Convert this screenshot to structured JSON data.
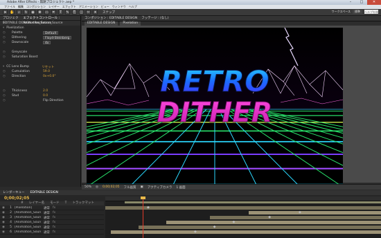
{
  "window": {
    "title": "Adobe After Effects - 無題プロジェクト.aep *"
  },
  "menu": [
    "ファイル",
    "編集",
    "コンポジション",
    "レイヤー",
    "エフェクト",
    "アニメーション",
    "ビュー",
    "ウィンドウ",
    "ヘルプ"
  ],
  "toolbar": {
    "icons": [
      "select",
      "hand",
      "zoom",
      "rotate",
      "camera",
      "pan",
      "rect",
      "pen",
      "text",
      "brush",
      "clone",
      "eraser",
      "roto",
      "puppet"
    ],
    "snap_label": "スナップ",
    "workspace_label": "ワークスペース",
    "workspace_value": "標準",
    "search_placeholder": "ヘルプを検索"
  },
  "left_panel": {
    "tabs": [
      "プロジェクト",
      "エフェクトコントロール : Animation_Source"
    ],
    "header": "EDITABLE DESIGN • Animation_Source",
    "rows": [
      {
        "label": "Pixelization",
        "value": "",
        "kind": "group"
      },
      {
        "label": "Palette",
        "value": "Default",
        "kind": "dropdown"
      },
      {
        "label": "Dithering",
        "value": "Floyd-Steinberg",
        "kind": "dropdown"
      },
      {
        "label": "Downscale",
        "value": "4x",
        "kind": "dropdown"
      },
      {
        "label": "",
        "value": "",
        "kind": "blank"
      },
      {
        "label": "Greyscale",
        "value": "",
        "kind": "check"
      },
      {
        "label": "Saturation Boost",
        "value": "",
        "kind": "check"
      },
      {
        "label": "",
        "value": "",
        "kind": "blank"
      },
      {
        "label": "CC Lens Bump",
        "value": "リセット",
        "kind": "group"
      },
      {
        "label": "Cumulation",
        "value": "59.0",
        "kind": "value"
      },
      {
        "label": "Direction",
        "value": "0x+0.0°",
        "kind": "value"
      },
      {
        "label": "",
        "value": "",
        "kind": "blank"
      },
      {
        "label": "",
        "value": "",
        "kind": "blank"
      },
      {
        "label": "Thickness",
        "value": "2.0",
        "kind": "value"
      },
      {
        "label": "Stud",
        "value": "0.0",
        "kind": "value"
      },
      {
        "label": "",
        "value": "Flip Direction",
        "kind": "check"
      }
    ]
  },
  "comp": {
    "header_tabs": [
      "コンポジション : EDITABLE DESIGN",
      "フッテージ : (なし)"
    ],
    "breadcrumb": [
      "EDITABLE DESIGN",
      "Pixelation"
    ],
    "title_line1": "RETRO",
    "title_line2": "DITHER",
    "viewer_controls": {
      "zoom": "50%",
      "timecode": "0;00;02;05",
      "resolution": "フル画質",
      "camera": "アクティブカメラ",
      "views": "1 画面"
    }
  },
  "timeline": {
    "tabs": [
      "レンダーキュー",
      "EDITABLE DESIGN"
    ],
    "timecode": "0;00;02;05",
    "columns": [
      "#",
      "レイヤー名",
      "モード",
      "T",
      "トラックマット"
    ],
    "layers": [
      {
        "num": "1",
        "name": "[Pixelation]",
        "mode": "通常"
      },
      {
        "num": "2",
        "name": "[Animation_Source]",
        "mode": "通常"
      },
      {
        "num": "3",
        "name": "[Animation_Source]",
        "mode": "通常"
      },
      {
        "num": "4",
        "name": "[Animation_Source]",
        "mode": "通常"
      },
      {
        "num": "5",
        "name": "[Animation_Source]",
        "mode": "通常"
      },
      {
        "num": "6",
        "name": "[Animation_Source]",
        "mode": "通常"
      }
    ]
  },
  "colors": {
    "accent": "#e8b94a",
    "playhead": "#e23a2a",
    "neon_pink": "#ff36c8",
    "neon_blue": "#22b8ff",
    "grid_green": "#28e06a"
  }
}
